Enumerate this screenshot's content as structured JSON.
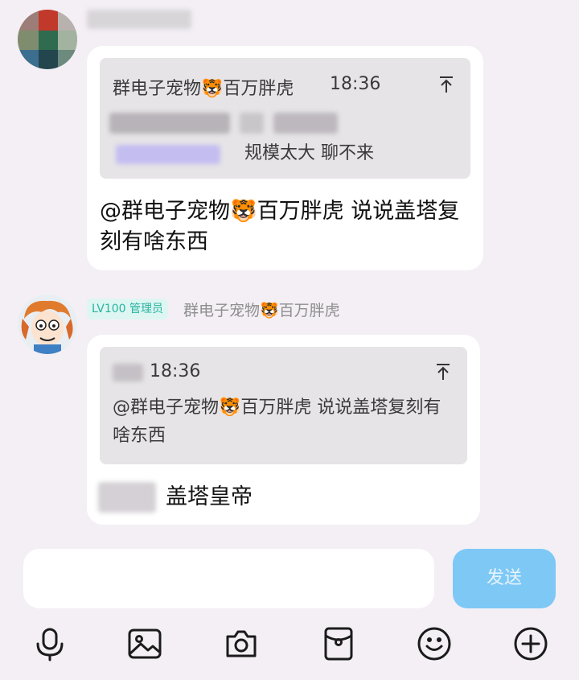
{
  "message1": {
    "quote": {
      "sender": "群电子宠物🐯百万胖虎",
      "time": "18:36",
      "text": "规模太大 聊不来"
    },
    "text": "@群电子宠物🐯百万胖虎 说说盖塔复刻有啥东西"
  },
  "message2": {
    "badge": "LV100 管理员",
    "nickname": "群电子宠物🐯百万胖虎",
    "quote": {
      "time": "18:36",
      "text": "@群电子宠物🐯百万胖虎 说说盖塔复刻有啥东西"
    },
    "text": "盖塔皇帝"
  },
  "composer": {
    "send_label": "发送"
  },
  "toolbar": {
    "icons": [
      "microphone-icon",
      "image-icon",
      "camera-icon",
      "red-packet-icon",
      "emoji-icon",
      "plus-icon"
    ]
  },
  "colors": {
    "background": "#f3eff5",
    "send_button": "#7ec8f6",
    "badge_text": "#27b3a1"
  }
}
